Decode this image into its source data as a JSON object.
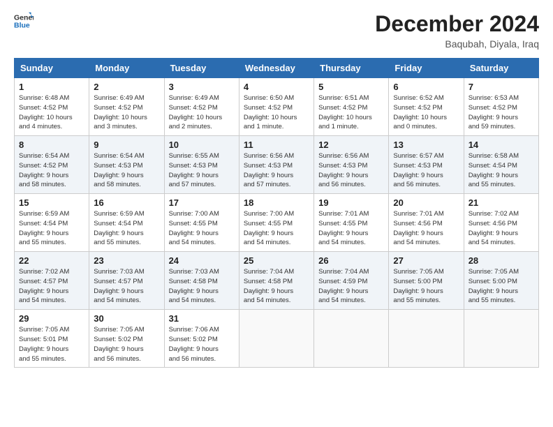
{
  "header": {
    "logo_general": "General",
    "logo_blue": "Blue",
    "month": "December 2024",
    "location": "Baqubah, Diyala, Iraq"
  },
  "weekdays": [
    "Sunday",
    "Monday",
    "Tuesday",
    "Wednesday",
    "Thursday",
    "Friday",
    "Saturday"
  ],
  "weeks": [
    [
      {
        "day": "1",
        "info": "Sunrise: 6:48 AM\nSunset: 4:52 PM\nDaylight: 10 hours\nand 4 minutes."
      },
      {
        "day": "2",
        "info": "Sunrise: 6:49 AM\nSunset: 4:52 PM\nDaylight: 10 hours\nand 3 minutes."
      },
      {
        "day": "3",
        "info": "Sunrise: 6:49 AM\nSunset: 4:52 PM\nDaylight: 10 hours\nand 2 minutes."
      },
      {
        "day": "4",
        "info": "Sunrise: 6:50 AM\nSunset: 4:52 PM\nDaylight: 10 hours\nand 1 minute."
      },
      {
        "day": "5",
        "info": "Sunrise: 6:51 AM\nSunset: 4:52 PM\nDaylight: 10 hours\nand 1 minute."
      },
      {
        "day": "6",
        "info": "Sunrise: 6:52 AM\nSunset: 4:52 PM\nDaylight: 10 hours\nand 0 minutes."
      },
      {
        "day": "7",
        "info": "Sunrise: 6:53 AM\nSunset: 4:52 PM\nDaylight: 9 hours\nand 59 minutes."
      }
    ],
    [
      {
        "day": "8",
        "info": "Sunrise: 6:54 AM\nSunset: 4:52 PM\nDaylight: 9 hours\nand 58 minutes."
      },
      {
        "day": "9",
        "info": "Sunrise: 6:54 AM\nSunset: 4:53 PM\nDaylight: 9 hours\nand 58 minutes."
      },
      {
        "day": "10",
        "info": "Sunrise: 6:55 AM\nSunset: 4:53 PM\nDaylight: 9 hours\nand 57 minutes."
      },
      {
        "day": "11",
        "info": "Sunrise: 6:56 AM\nSunset: 4:53 PM\nDaylight: 9 hours\nand 57 minutes."
      },
      {
        "day": "12",
        "info": "Sunrise: 6:56 AM\nSunset: 4:53 PM\nDaylight: 9 hours\nand 56 minutes."
      },
      {
        "day": "13",
        "info": "Sunrise: 6:57 AM\nSunset: 4:53 PM\nDaylight: 9 hours\nand 56 minutes."
      },
      {
        "day": "14",
        "info": "Sunrise: 6:58 AM\nSunset: 4:54 PM\nDaylight: 9 hours\nand 55 minutes."
      }
    ],
    [
      {
        "day": "15",
        "info": "Sunrise: 6:59 AM\nSunset: 4:54 PM\nDaylight: 9 hours\nand 55 minutes."
      },
      {
        "day": "16",
        "info": "Sunrise: 6:59 AM\nSunset: 4:54 PM\nDaylight: 9 hours\nand 55 minutes."
      },
      {
        "day": "17",
        "info": "Sunrise: 7:00 AM\nSunset: 4:55 PM\nDaylight: 9 hours\nand 54 minutes."
      },
      {
        "day": "18",
        "info": "Sunrise: 7:00 AM\nSunset: 4:55 PM\nDaylight: 9 hours\nand 54 minutes."
      },
      {
        "day": "19",
        "info": "Sunrise: 7:01 AM\nSunset: 4:55 PM\nDaylight: 9 hours\nand 54 minutes."
      },
      {
        "day": "20",
        "info": "Sunrise: 7:01 AM\nSunset: 4:56 PM\nDaylight: 9 hours\nand 54 minutes."
      },
      {
        "day": "21",
        "info": "Sunrise: 7:02 AM\nSunset: 4:56 PM\nDaylight: 9 hours\nand 54 minutes."
      }
    ],
    [
      {
        "day": "22",
        "info": "Sunrise: 7:02 AM\nSunset: 4:57 PM\nDaylight: 9 hours\nand 54 minutes."
      },
      {
        "day": "23",
        "info": "Sunrise: 7:03 AM\nSunset: 4:57 PM\nDaylight: 9 hours\nand 54 minutes."
      },
      {
        "day": "24",
        "info": "Sunrise: 7:03 AM\nSunset: 4:58 PM\nDaylight: 9 hours\nand 54 minutes."
      },
      {
        "day": "25",
        "info": "Sunrise: 7:04 AM\nSunset: 4:58 PM\nDaylight: 9 hours\nand 54 minutes."
      },
      {
        "day": "26",
        "info": "Sunrise: 7:04 AM\nSunset: 4:59 PM\nDaylight: 9 hours\nand 54 minutes."
      },
      {
        "day": "27",
        "info": "Sunrise: 7:05 AM\nSunset: 5:00 PM\nDaylight: 9 hours\nand 55 minutes."
      },
      {
        "day": "28",
        "info": "Sunrise: 7:05 AM\nSunset: 5:00 PM\nDaylight: 9 hours\nand 55 minutes."
      }
    ],
    [
      {
        "day": "29",
        "info": "Sunrise: 7:05 AM\nSunset: 5:01 PM\nDaylight: 9 hours\nand 55 minutes."
      },
      {
        "day": "30",
        "info": "Sunrise: 7:05 AM\nSunset: 5:02 PM\nDaylight: 9 hours\nand 56 minutes."
      },
      {
        "day": "31",
        "info": "Sunrise: 7:06 AM\nSunset: 5:02 PM\nDaylight: 9 hours\nand 56 minutes."
      },
      {
        "day": "",
        "info": ""
      },
      {
        "day": "",
        "info": ""
      },
      {
        "day": "",
        "info": ""
      },
      {
        "day": "",
        "info": ""
      }
    ]
  ]
}
